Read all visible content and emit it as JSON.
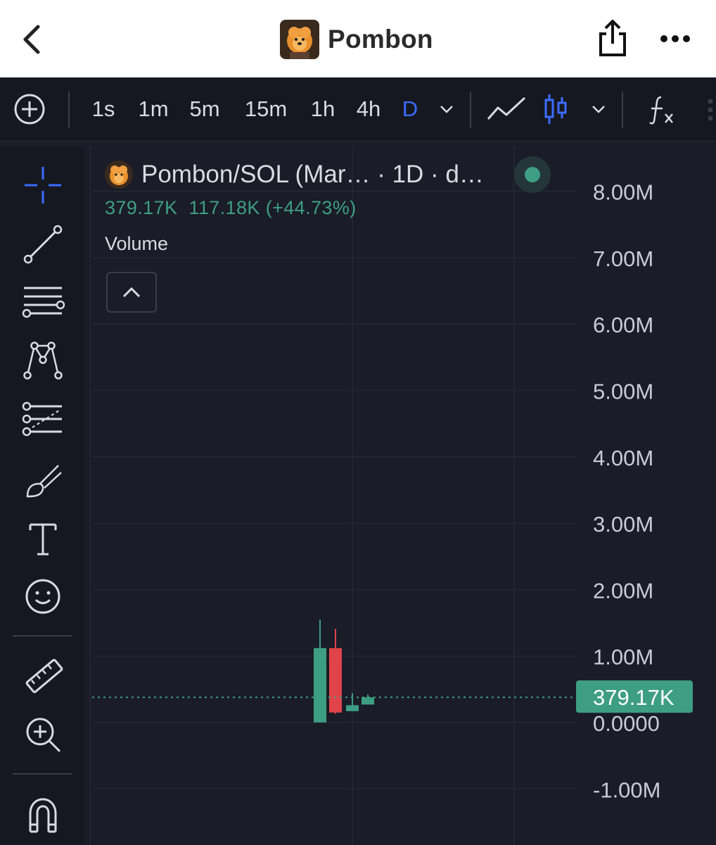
{
  "header": {
    "title": "Pombon"
  },
  "toolbar": {
    "intervals": [
      "1s",
      "1m",
      "5m",
      "15m",
      "1h",
      "4h",
      "D"
    ],
    "active_interval": "D"
  },
  "legend": {
    "symbol": "Pombon/SOL (Mar… · 1D · d…",
    "last_value": "379.17K",
    "change": "117.18K (+44.73%)",
    "indicator": "Volume"
  },
  "colors": {
    "up": "#3e9e84",
    "down": "#e0434a",
    "accent": "#3b6cff",
    "background": "#1a1c27"
  },
  "chart_data": {
    "type": "candlestick",
    "y_axis": {
      "min": -1000000,
      "max": 8000000,
      "ticks": [
        8000000,
        7000000,
        6000000,
        5000000,
        4000000,
        3000000,
        2000000,
        1000000,
        0,
        -1000000
      ],
      "tick_labels": [
        "8.00M",
        "7.00M",
        "6.00M",
        "5.00M",
        "4.00M",
        "3.00M",
        "2.00M",
        "1.00M",
        "0.0000",
        "-1.00M"
      ],
      "position": "right"
    },
    "candles": [
      {
        "open": 0,
        "high": 1550000,
        "low": 0,
        "close": 1120000,
        "direction": "up"
      },
      {
        "open": 1120000,
        "high": 1410000,
        "low": 130000,
        "close": 150000,
        "direction": "down"
      },
      {
        "open": 170000,
        "high": 440000,
        "low": 170000,
        "close": 260000,
        "direction": "up"
      },
      {
        "open": 270000,
        "high": 420000,
        "low": 270000,
        "close": 379170,
        "direction": "up"
      }
    ],
    "last_price": 379170,
    "last_price_label": "379.17K",
    "grid": true
  }
}
